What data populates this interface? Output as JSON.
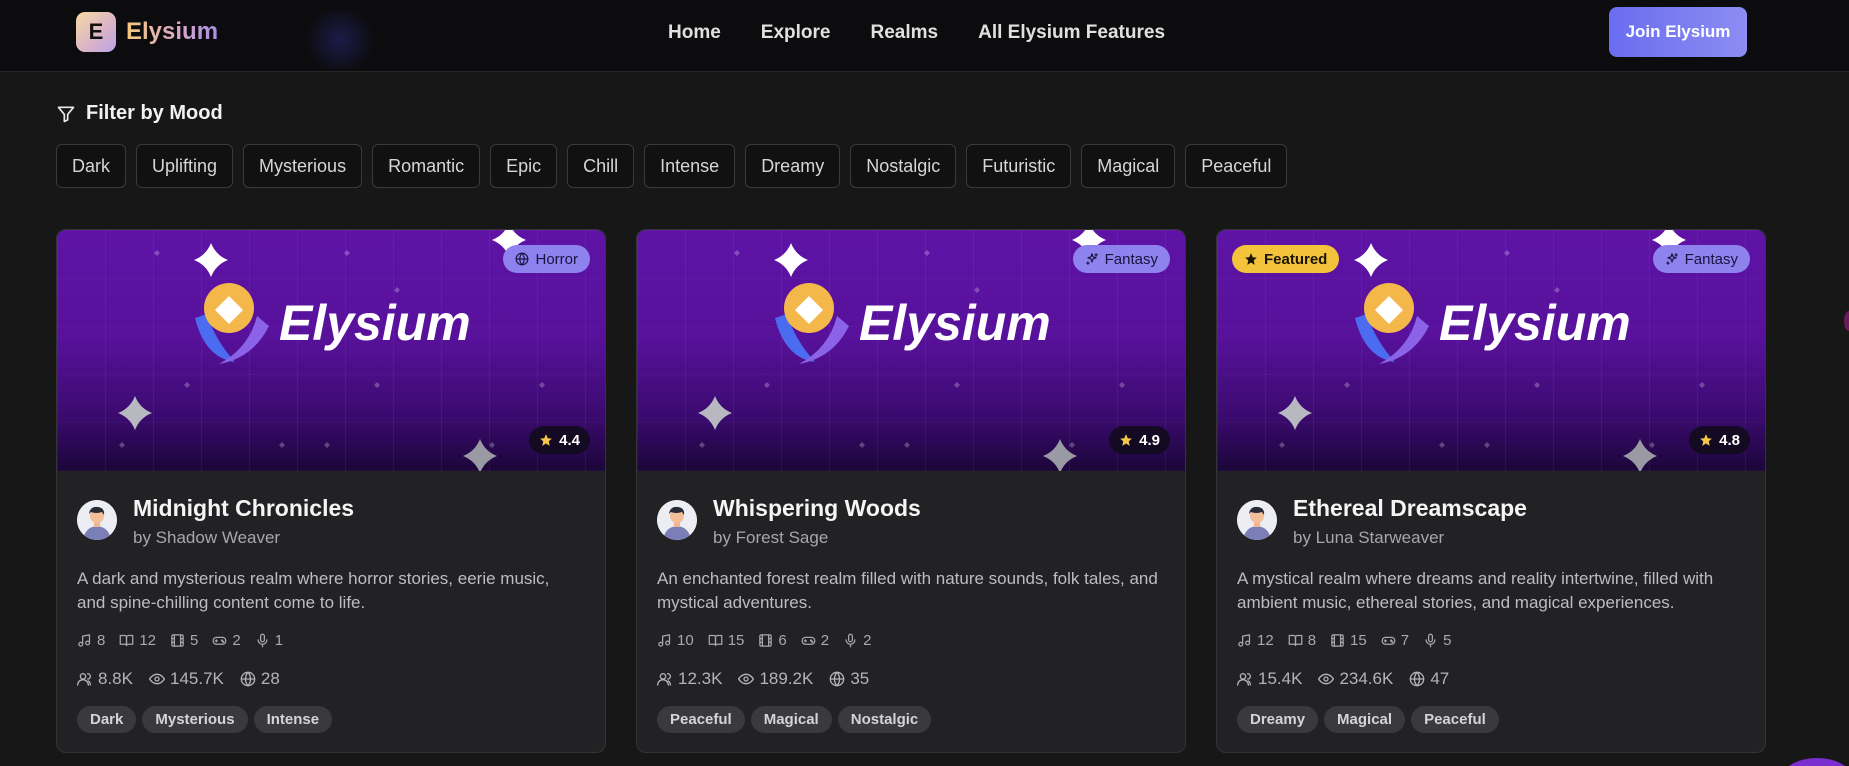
{
  "nav": {
    "brand_letter": "E",
    "brand_name": "Elysium",
    "links": [
      "Home",
      "Explore",
      "Realms",
      "All Elysium Features"
    ],
    "join_label": "Join Elysium"
  },
  "filter": {
    "title": "Filter by Mood",
    "moods": [
      "Dark",
      "Uplifting",
      "Mysterious",
      "Romantic",
      "Epic",
      "Chill",
      "Intense",
      "Dreamy",
      "Nostalgic",
      "Futuristic",
      "Magical",
      "Peaceful"
    ]
  },
  "banner_logo_text": "Elysium",
  "featured_label": "Featured",
  "cards": [
    {
      "title": "Midnight Chronicles",
      "author": "by Shadow Weaver",
      "genre": "Horror",
      "genre_icon": "globe-icon",
      "rating": "4.4",
      "featured": false,
      "description": "A dark and mysterious realm where horror stories, eerie music, and spine-chilling content come to life.",
      "music": "8",
      "books": "12",
      "films": "5",
      "games": "2",
      "podcasts": "1",
      "members": "8.8K",
      "views": "145.7K",
      "worlds": "28",
      "tags": [
        "Dark",
        "Mysterious",
        "Intense"
      ]
    },
    {
      "title": "Whispering Woods",
      "author": "by Forest Sage",
      "genre": "Fantasy",
      "genre_icon": "sparkles-icon",
      "rating": "4.9",
      "featured": false,
      "description": "An enchanted forest realm filled with nature sounds, folk tales, and mystical adventures.",
      "music": "10",
      "books": "15",
      "films": "6",
      "games": "2",
      "podcasts": "2",
      "members": "12.3K",
      "views": "189.2K",
      "worlds": "35",
      "tags": [
        "Peaceful",
        "Magical",
        "Nostalgic"
      ]
    },
    {
      "title": "Ethereal Dreamscape",
      "author": "by Luna Starweaver",
      "genre": "Fantasy",
      "genre_icon": "sparkles-icon",
      "rating": "4.8",
      "featured": true,
      "description": "A mystical realm where dreams and reality intertwine, filled with ambient music, ethereal stories, and magical experiences.",
      "music": "12",
      "books": "8",
      "films": "15",
      "games": "7",
      "podcasts": "5",
      "members": "15.4K",
      "views": "234.6K",
      "worlds": "47",
      "tags": [
        "Dreamy",
        "Magical",
        "Peaceful"
      ]
    }
  ],
  "colors": {
    "accent": "#7b7ef0",
    "banner_purple": "#5e13a6",
    "featured_yellow": "#f3c33c",
    "genre_badge": "#8e83ee"
  }
}
